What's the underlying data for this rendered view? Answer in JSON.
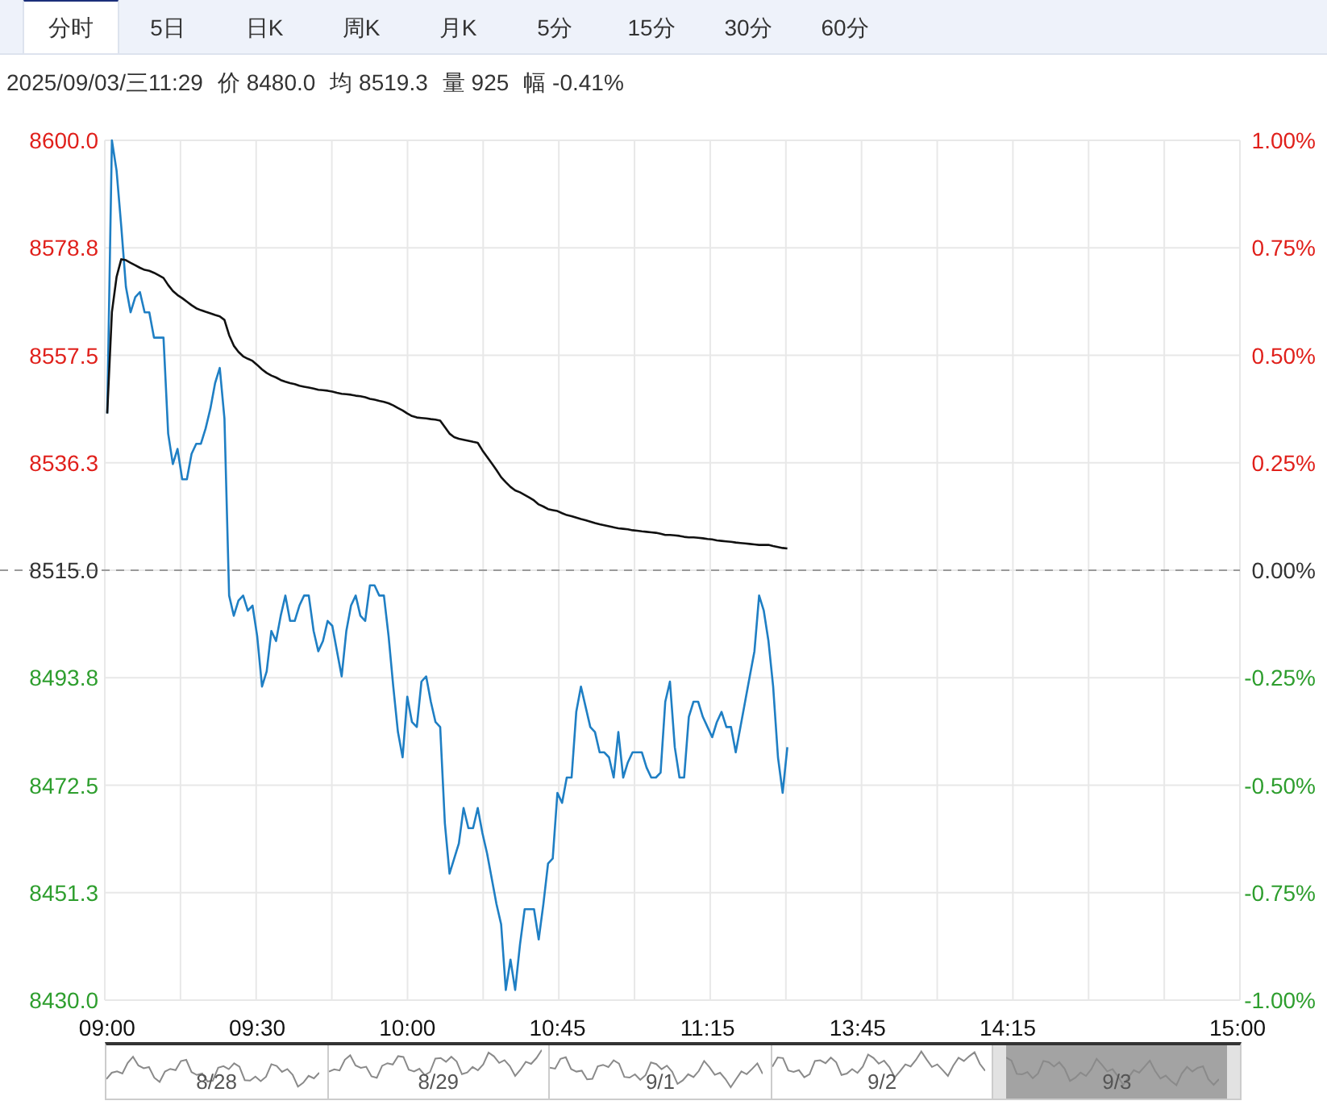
{
  "tabs": [
    {
      "label": "分时",
      "selected": true
    },
    {
      "label": "5日",
      "selected": false
    },
    {
      "label": "日K",
      "selected": false
    },
    {
      "label": "周K",
      "selected": false
    },
    {
      "label": "月K",
      "selected": false
    },
    {
      "label": "5分",
      "selected": false
    },
    {
      "label": "15分",
      "selected": false
    },
    {
      "label": "30分",
      "selected": false
    },
    {
      "label": "60分",
      "selected": false
    }
  ],
  "info": {
    "datetime": "2025/09/03/三11:29",
    "fields": [
      {
        "label": "价",
        "value": "8480.0"
      },
      {
        "label": "均",
        "value": "8519.3"
      },
      {
        "label": "量",
        "value": "925"
      },
      {
        "label": "幅",
        "value": "-0.41%"
      }
    ]
  },
  "chart": {
    "chart_data": {
      "type": "line",
      "ylim": [
        8430,
        8600
      ],
      "yticks": [
        {
          "value": 8600,
          "label": "8600.0"
        },
        {
          "value": 8578.75,
          "label": "8578.8"
        },
        {
          "value": 8557.5,
          "label": "8557.5"
        },
        {
          "value": 8536.25,
          "label": "8536.3"
        },
        {
          "value": 8515,
          "label": "8515.0"
        },
        {
          "value": 8493.75,
          "label": "8493.8"
        },
        {
          "value": 8472.5,
          "label": "8472.5"
        },
        {
          "value": 8451.25,
          "label": "8451.3"
        },
        {
          "value": 8430,
          "label": "8430.0"
        }
      ],
      "categories": [
        "09:00",
        null,
        null,
        null,
        null,
        null,
        null,
        null,
        null,
        null,
        null,
        null,
        null,
        null,
        null,
        null,
        null,
        null,
        null,
        null,
        null,
        null,
        null,
        null,
        null,
        null,
        null,
        null,
        null,
        null,
        null,
        null,
        "09:30",
        null,
        null,
        null,
        null,
        null,
        null,
        null,
        null,
        null,
        null,
        null,
        null,
        null,
        null,
        null,
        null,
        null,
        null,
        null,
        null,
        null,
        null,
        null,
        null,
        null,
        null,
        null,
        null,
        null,
        null,
        null,
        "10:00",
        null,
        null,
        null,
        null,
        null,
        null,
        null,
        null,
        null,
        null,
        null,
        null,
        null,
        null,
        null,
        null,
        null,
        null,
        null,
        null,
        null,
        null,
        null,
        null,
        null,
        null,
        null,
        null,
        null,
        null,
        null,
        "10:45",
        null,
        null,
        null,
        null,
        null,
        null,
        null,
        null,
        null,
        null,
        null,
        null,
        null,
        null,
        null,
        null,
        null,
        null,
        null,
        null,
        null,
        null,
        null,
        null,
        null,
        null,
        null,
        null,
        null,
        null,
        null,
        "11:15",
        null,
        null,
        null,
        null,
        null,
        null,
        null,
        null,
        null,
        null,
        null,
        null,
        null,
        null,
        null,
        null,
        null,
        null,
        null,
        null,
        null,
        null,
        null,
        null,
        null,
        null,
        null,
        null,
        null,
        null,
        null,
        "13:45",
        null,
        null,
        null,
        null,
        null,
        null,
        null,
        null,
        null,
        null,
        null,
        null,
        null,
        null,
        null,
        null,
        null,
        null,
        null,
        null,
        null,
        null,
        null,
        null,
        null,
        null,
        null,
        null,
        null,
        null,
        null,
        "14:15",
        null,
        null,
        null,
        null,
        null,
        null,
        null,
        null,
        null,
        null,
        null,
        null,
        null,
        null,
        null,
        null,
        null,
        null,
        null,
        null,
        null,
        null,
        null,
        null,
        null,
        null,
        null,
        null,
        null,
        null,
        null,
        null,
        null,
        null,
        null,
        null,
        null,
        null,
        null,
        null,
        null,
        null,
        null,
        null,
        null,
        null,
        null,
        null,
        "15:00"
      ],
      "series": [
        {
          "color": "#1f7fc4",
          "values": [
            8546,
            8600,
            8594,
            8583,
            8571,
            8566,
            8569,
            8570,
            8566,
            8566,
            8561,
            8561,
            8561,
            8542,
            8536,
            8539,
            8533,
            8533,
            8538,
            8540,
            8540,
            8543,
            8547,
            8552,
            8555,
            8545,
            8510,
            8506,
            8509,
            8510,
            8507,
            8508,
            8502,
            8492,
            8495,
            8503,
            8501,
            8506,
            8510,
            8505,
            8505,
            8508,
            8510,
            8510,
            8503,
            8499,
            8501,
            8505,
            8504,
            8499,
            8494,
            8503,
            8508,
            8510,
            8506,
            8505,
            8512,
            8512,
            8510,
            8510,
            8502,
            8492,
            8483,
            8478,
            8490,
            8485,
            8484,
            8493,
            8494,
            8489,
            8485,
            8484,
            8465,
            8455,
            8458,
            8461,
            8468,
            8464,
            8464,
            8468,
            8463,
            8459,
            8454,
            8449,
            8445,
            8432,
            8438,
            8432,
            8441,
            8448,
            8448,
            8448,
            8442,
            8449,
            8457,
            8458,
            8471,
            8469,
            8474,
            8474,
            8487,
            8492,
            8488,
            8484,
            8483,
            8479,
            8479,
            8478,
            8474,
            8483,
            8474,
            8477,
            8479,
            8479,
            8479,
            8476,
            8474,
            8474,
            8475,
            8489,
            8493,
            8480,
            8474,
            8474,
            8486,
            8489,
            8489,
            8486,
            8484,
            8482,
            8485,
            8487,
            8484,
            8484,
            8479,
            8484,
            8489,
            8494,
            8499,
            8510,
            8507,
            8501,
            8492,
            8478,
            8471,
            8480,
            null,
            null,
            null,
            null,
            null,
            null,
            null,
            null,
            null,
            null,
            null,
            null,
            null,
            null,
            null,
            null,
            null,
            null,
            null,
            null,
            null,
            null,
            null,
            null,
            null,
            null,
            null,
            null,
            null,
            null,
            null,
            null,
            null,
            null,
            null,
            null,
            null,
            null,
            null,
            null,
            null,
            null,
            null,
            null,
            null,
            null,
            null,
            null,
            null,
            null,
            null,
            null,
            null,
            null,
            null,
            null,
            null,
            null,
            null,
            null,
            null,
            null,
            null,
            null,
            null,
            null,
            null,
            null,
            null,
            null,
            null,
            null,
            null,
            null,
            null,
            null,
            null,
            null,
            null,
            null,
            null,
            null,
            null,
            null,
            null,
            null,
            null,
            null,
            null,
            null,
            null,
            null,
            null,
            null,
            null,
            null
          ]
        },
        {
          "color": "#111111",
          "values": [
            8546,
            8566,
            8573,
            8576.5,
            8576.3,
            8575.8,
            8575.3,
            8574.8,
            8574.4,
            8574.2,
            8573.8,
            8573.3,
            8572.8,
            8571.4,
            8570.2,
            8569.4,
            8568.8,
            8568.1,
            8567.4,
            8566.8,
            8566.4,
            8566.1,
            8565.8,
            8565.5,
            8565.2,
            8564.5,
            8561.5,
            8559.4,
            8558.2,
            8557.3,
            8556.8,
            8556.4,
            8555.6,
            8554.7,
            8554,
            8553.5,
            8553.1,
            8552.6,
            8552.3,
            8552,
            8551.8,
            8551.5,
            8551.3,
            8551.1,
            8550.9,
            8550.7,
            8550.6,
            8550.5,
            8550.3,
            8550.1,
            8549.9,
            8549.8,
            8549.7,
            8549.5,
            8549.4,
            8549.2,
            8548.9,
            8548.7,
            8548.5,
            8548.3,
            8548,
            8547.6,
            8547.1,
            8546.6,
            8546,
            8545.5,
            8545.2,
            8545.1,
            8545,
            8544.9,
            8544.8,
            8544.6,
            8543.3,
            8542,
            8541.3,
            8541,
            8540.8,
            8540.6,
            8540.4,
            8540.2,
            8538.7,
            8537.4,
            8536.1,
            8534.8,
            8533.4,
            8532.4,
            8531.5,
            8530.8,
            8530.4,
            8529.9,
            8529.4,
            8528.8,
            8528,
            8527.6,
            8527.1,
            8526.9,
            8526.7,
            8526.3,
            8525.9,
            8525.7,
            8525.4,
            8525.1,
            8524.9,
            8524.6,
            8524.3,
            8524.1,
            8523.9,
            8523.7,
            8523.5,
            8523.3,
            8523.2,
            8523.1,
            8522.9,
            8522.8,
            8522.7,
            8522.6,
            8522.5,
            8522.4,
            8522.2,
            8522,
            8522,
            8521.9,
            8521.8,
            8521.6,
            8521.5,
            8521.5,
            8521.4,
            8521.3,
            8521.2,
            8521.1,
            8520.9,
            8520.8,
            8520.7,
            8520.6,
            8520.5,
            8520.4,
            8520.3,
            8520.2,
            8520.1,
            8520,
            8520,
            8520,
            8519.8,
            8519.6,
            8519.4,
            8519.3,
            null,
            null,
            null,
            null,
            null,
            null,
            null,
            null,
            null,
            null,
            null,
            null,
            null,
            null,
            null,
            null,
            null,
            null,
            null,
            null,
            null,
            null,
            null,
            null,
            null,
            null,
            null,
            null,
            null,
            null,
            null,
            null,
            null,
            null,
            null,
            null,
            null,
            null,
            null,
            null,
            null,
            null,
            null,
            null,
            null,
            null,
            null,
            null,
            null,
            null,
            null,
            null,
            null,
            null,
            null,
            null,
            null,
            null,
            null,
            null,
            null,
            null,
            null,
            null,
            null,
            null,
            null,
            null,
            null,
            null,
            null,
            null,
            null,
            null,
            null,
            null,
            null,
            null,
            null,
            null,
            null,
            null,
            null,
            null,
            null,
            null,
            null,
            null,
            null,
            null,
            null,
            null,
            null,
            null,
            null,
            null
          ]
        }
      ],
      "ref_lines": [
        {
          "axis": "y",
          "value": 8515
        }
      ],
      "grid": true
    },
    "percent_labels": [
      "1.00%",
      "0.75%",
      "0.50%",
      "0.25%",
      "0.00%",
      "-0.25%",
      "-0.50%",
      "-0.75%",
      "-1.00%"
    ]
  },
  "navigator": {
    "days": [
      {
        "label": "8/28",
        "selected": false
      },
      {
        "label": "8/29",
        "selected": false
      },
      {
        "label": "9/1",
        "selected": false
      },
      {
        "label": "9/2",
        "selected": false
      },
      {
        "label": "9/3",
        "selected": true
      }
    ]
  }
}
